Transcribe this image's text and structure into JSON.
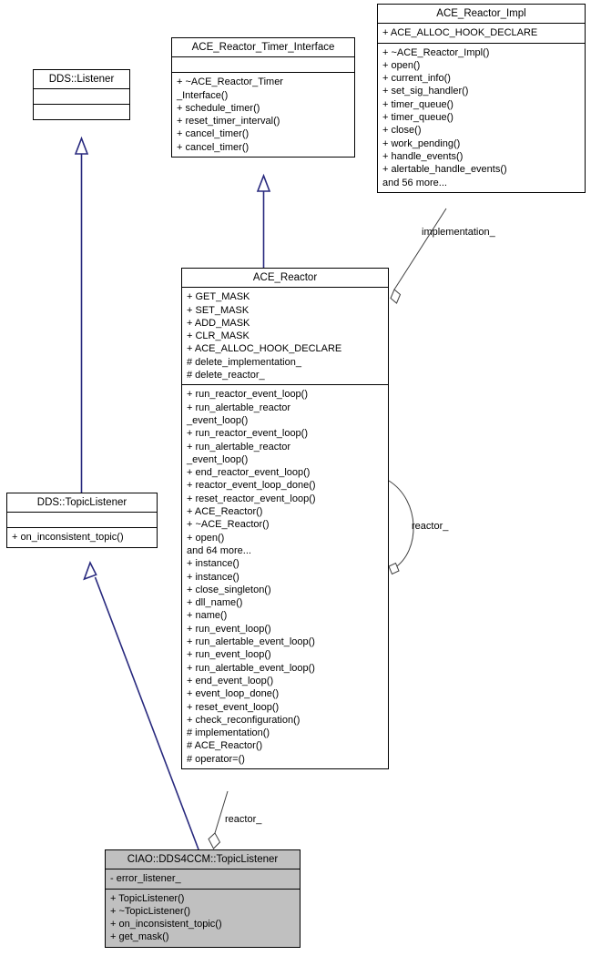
{
  "diagram": {
    "title": "UML class inheritance diagram for CIAO::DDS4CCM::TopicListener",
    "colors": {
      "inheritance_line": "#28297e",
      "association_line": "#404040",
      "box_border": "#000000",
      "box_fill": "#ffffff",
      "highlight_fill": "#c0c0c0",
      "background": "#ffffff"
    }
  },
  "classes": {
    "dds_listener": {
      "name": "DDS::Listener",
      "attributes": [],
      "operations": []
    },
    "ace_reactor_timer_interface": {
      "name": "ACE_Reactor_Timer_Interface",
      "attributes": [],
      "operations": [
        "+ ~ACE_Reactor_Timer",
        "_Interface()",
        "+ schedule_timer()",
        "+ reset_timer_interval()",
        "+ cancel_timer()",
        "+ cancel_timer()"
      ]
    },
    "ace_reactor_impl": {
      "name": "ACE_Reactor_Impl",
      "attributes": [
        "+ ACE_ALLOC_HOOK_DECLARE"
      ],
      "operations": [
        "+ ~ACE_Reactor_Impl()",
        "+ open()",
        "+ current_info()",
        "+ set_sig_handler()",
        "+ timer_queue()",
        "+ timer_queue()",
        "+ close()",
        "+ work_pending()",
        "+ handle_events()",
        "+ alertable_handle_events()",
        "and 56 more..."
      ]
    },
    "ace_reactor": {
      "name": "ACE_Reactor",
      "attributes": [
        "+ GET_MASK",
        "+ SET_MASK",
        "+ ADD_MASK",
        "+ CLR_MASK",
        "+ ACE_ALLOC_HOOK_DECLARE",
        "# delete_implementation_",
        "# delete_reactor_"
      ],
      "operations": [
        "+ run_reactor_event_loop()",
        "+ run_alertable_reactor",
        "_event_loop()",
        "+ run_reactor_event_loop()",
        "+ run_alertable_reactor",
        "_event_loop()",
        "+ end_reactor_event_loop()",
        "+ reactor_event_loop_done()",
        "+ reset_reactor_event_loop()",
        "+ ACE_Reactor()",
        "+ ~ACE_Reactor()",
        "+ open()",
        "and 64 more...",
        "+ instance()",
        "+ instance()",
        "+ close_singleton()",
        "+ dll_name()",
        "+ name()",
        "+ run_event_loop()",
        "+ run_alertable_event_loop()",
        "+ run_event_loop()",
        "+ run_alertable_event_loop()",
        "+ end_event_loop()",
        "+ event_loop_done()",
        "+ reset_event_loop()",
        "+ check_reconfiguration()",
        "# implementation()",
        "# ACE_Reactor()",
        "# operator=()"
      ]
    },
    "dds_topiclistener": {
      "name": "DDS::TopicListener",
      "attributes": [],
      "operations": [
        "+ on_inconsistent_topic()"
      ]
    },
    "ciao_topiclistener": {
      "name": "CIAO::DDS4CCM::TopicListener",
      "attributes": [
        "- error_listener_"
      ],
      "operations": [
        "+ TopicListener()",
        "+ ~TopicListener()",
        "+ on_inconsistent_topic()",
        "+ get_mask()"
      ]
    }
  },
  "edge_labels": {
    "implementation": "implementation_",
    "reactor_self": "reactor_",
    "reactor_bottom": "reactor_"
  }
}
